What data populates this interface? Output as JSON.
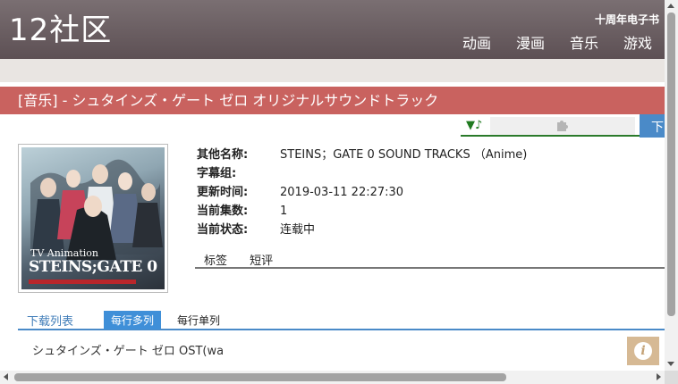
{
  "header": {
    "logo": "12社区",
    "top_link": "十周年电子书",
    "nav": [
      "动画",
      "漫画",
      "音乐",
      "游戏"
    ]
  },
  "title": "[音乐] - シュタインズ・ゲート ゼロ オリジナルサウンドトラック",
  "player": {
    "music_icon": "music-note-icon",
    "plugin_icon": "puzzle-icon",
    "download_label": "下"
  },
  "cover": {
    "subtitle": "TV Animation",
    "title": "STEINS;GATE 0"
  },
  "info": [
    {
      "label": "其他名称:",
      "value": "STEINS；GATE 0 SOUND TRACKS （Anime)"
    },
    {
      "label": "字幕组:",
      "value": ""
    },
    {
      "label": "更新时间:",
      "value": "2019-03-11 22:27:30"
    },
    {
      "label": "当前集数:",
      "value": "1"
    },
    {
      "label": "当前状态:",
      "value": "连载中"
    }
  ],
  "tabs": [
    "标签",
    "短评"
  ],
  "downloads": {
    "label": "下载列表",
    "option_multi": "每行多列",
    "option_single": "每行单列",
    "items": [
      "シュタインズ・ゲート ゼロ OST(wa"
    ]
  },
  "colors": {
    "header": "#6b5e62",
    "title_bar": "#c9625f",
    "accent_blue": "#3f8fd8",
    "info_button": "#d6b994"
  }
}
